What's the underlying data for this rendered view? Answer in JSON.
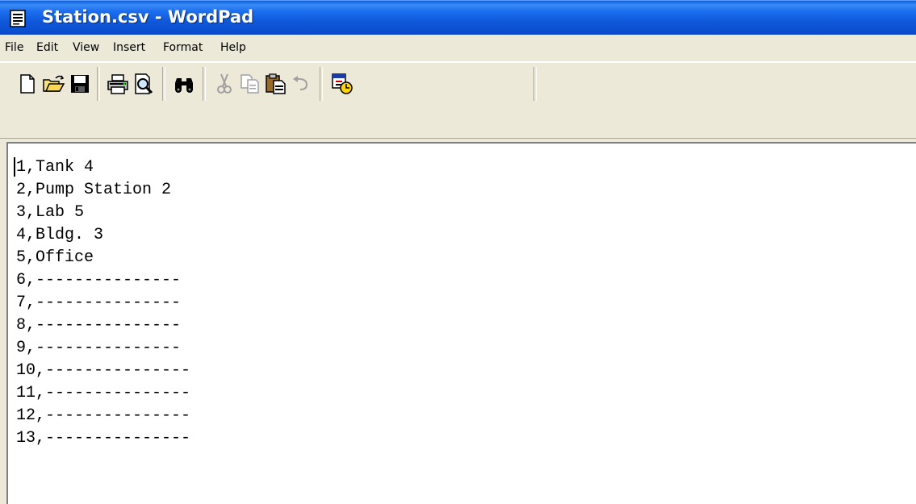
{
  "window": {
    "title": "Station.csv - WordPad",
    "app_icon": "notepad-document-icon"
  },
  "menu": {
    "items": [
      "File",
      "Edit",
      "View",
      "Insert",
      "Format",
      "Help"
    ]
  },
  "toolbar": {
    "buttons": [
      {
        "icon": "new-document-icon",
        "enabled": true
      },
      {
        "icon": "open-folder-icon",
        "enabled": true
      },
      {
        "icon": "save-disk-icon",
        "enabled": true
      },
      {
        "icon": "print-icon",
        "enabled": true
      },
      {
        "icon": "print-preview-icon",
        "enabled": true
      },
      {
        "icon": "find-binoculars-icon",
        "enabled": true
      },
      {
        "icon": "cut-scissors-icon",
        "enabled": false
      },
      {
        "icon": "copy-icon",
        "enabled": false
      },
      {
        "icon": "paste-clipboard-icon",
        "enabled": true
      },
      {
        "icon": "undo-icon",
        "enabled": false
      },
      {
        "icon": "insert-date-time-icon",
        "enabled": true
      }
    ]
  },
  "document": {
    "lines": [
      "1,Tank 4",
      "2,Pump Station 2",
      "3,Lab 5",
      "4,Bldg. 3",
      "5,Office",
      "6,---------------",
      "7,---------------",
      "8,---------------",
      "9,---------------",
      "10,---------------",
      "11,---------------",
      "12,---------------",
      "13,---------------"
    ]
  },
  "colors": {
    "titlebar": "#0b55d8",
    "chrome": "#ece9d8",
    "document_bg": "#ffffff"
  }
}
